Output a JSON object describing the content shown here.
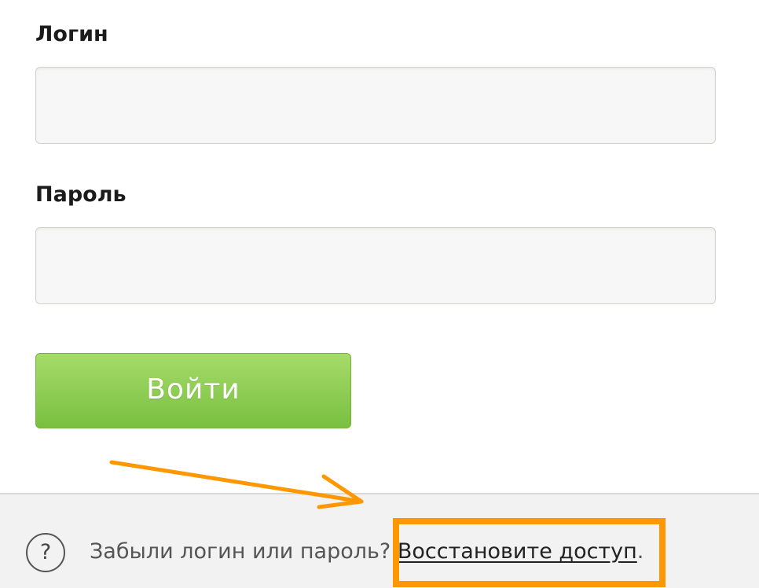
{
  "form": {
    "login_label": "Логин",
    "login_value": "",
    "password_label": "Пароль",
    "password_value": "",
    "submit_label": "Войти"
  },
  "footer": {
    "help_icon": "question-circle-icon",
    "help_icon_glyph": "?",
    "help_text": "Забыли логин или пароль?",
    "restore_link_label": "Восстановите доступ",
    "trailing_period": "."
  },
  "annotations": {
    "accent_color": "#ff9800"
  },
  "colors": {
    "button_green": "#8fcd55",
    "footer_bg": "#f2f2f2",
    "input_bg": "#f7f7f7"
  }
}
